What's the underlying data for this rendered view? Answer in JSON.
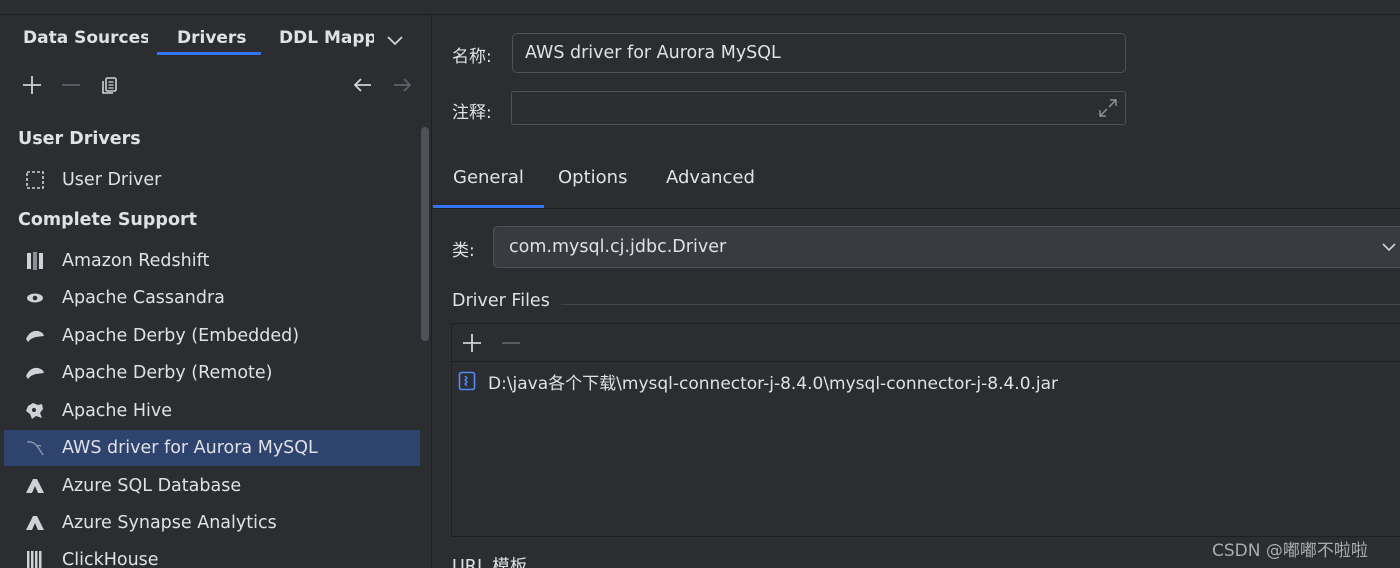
{
  "left_tabs": {
    "data_sources": "Data Sources",
    "drivers": "Drivers",
    "ddl_mappings": "DDL Mapp"
  },
  "toolbar": {
    "add": "add-icon",
    "remove": "minus-icon",
    "duplicate": "copy-icon",
    "back": "arrow-left-icon",
    "forward": "arrow-right-icon"
  },
  "sections": {
    "user_drivers": "User Drivers",
    "complete_support": "Complete Support"
  },
  "user_drivers": [
    {
      "label": "User Driver",
      "icon": "user-driver-icon"
    }
  ],
  "drivers": [
    {
      "label": "Amazon Redshift",
      "icon": "redshift-icon"
    },
    {
      "label": "Apache Cassandra",
      "icon": "cassandra-icon"
    },
    {
      "label": "Apache Derby (Embedded)",
      "icon": "derby-icon"
    },
    {
      "label": "Apache Derby (Remote)",
      "icon": "derby-icon"
    },
    {
      "label": "Apache Hive",
      "icon": "hive-icon"
    },
    {
      "label": "AWS driver for Aurora MySQL",
      "icon": "mysql-dolphin-icon",
      "selected": true
    },
    {
      "label": "Azure SQL Database",
      "icon": "azure-icon"
    },
    {
      "label": "Azure Synapse Analytics",
      "icon": "azure-icon"
    },
    {
      "label": "ClickHouse",
      "icon": "clickhouse-icon"
    }
  ],
  "form": {
    "name_label": "名称:",
    "name_value": "AWS driver for Aurora MySQL",
    "comment_label": "注释:",
    "comment_value": ""
  },
  "right_tabs": [
    "General",
    "Options",
    "Advanced"
  ],
  "class_label": "类:",
  "class_value": "com.mysql.cj.jdbc.Driver",
  "driver_files": {
    "title": "Driver Files",
    "files": [
      "D:\\java各个下载\\mysql-connector-j-8.4.0\\mysql-connector-j-8.4.0.jar"
    ]
  },
  "url_templates_label": "URL 模板",
  "watermark": "CSDN @嘟嘟不啦啦",
  "colors": {
    "background": "#2b2d30",
    "accent": "#3574f0",
    "selection": "#2e436e",
    "text": "#dfe1e5"
  }
}
